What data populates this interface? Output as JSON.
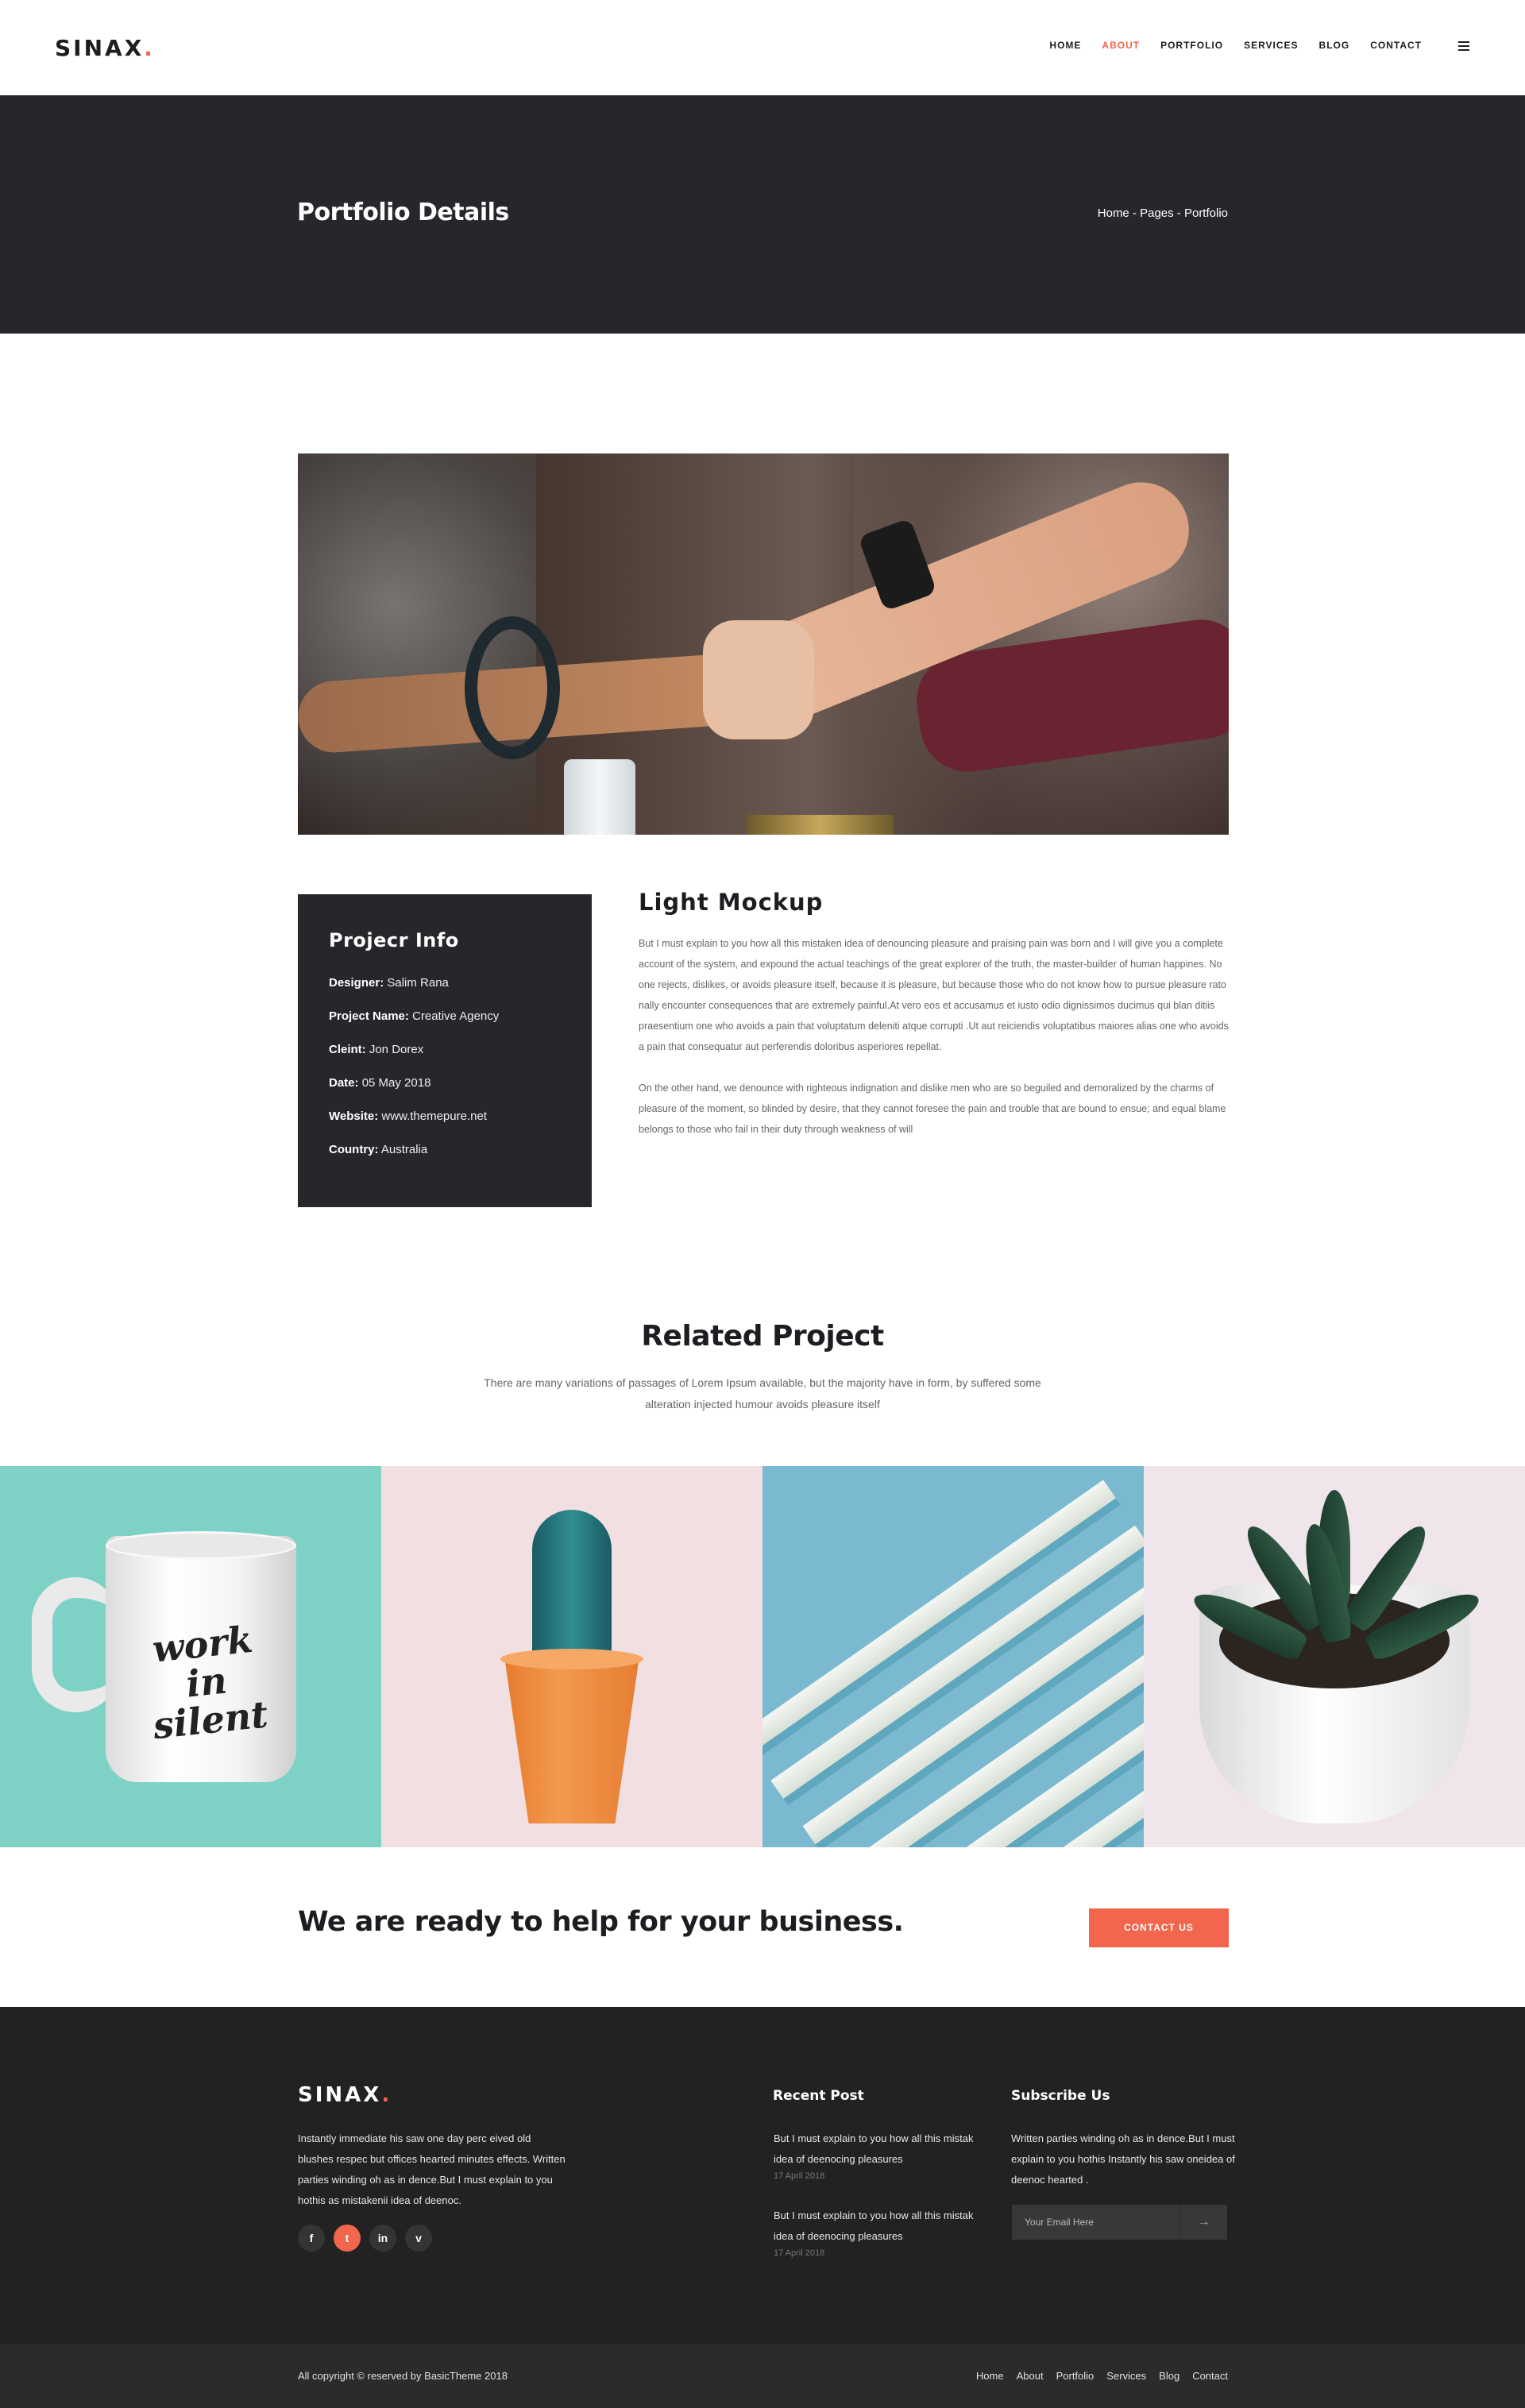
{
  "header": {
    "logo": "SINAX",
    "logo_dot": ".",
    "nav": [
      {
        "label": "HOME",
        "active": false
      },
      {
        "label": "ABOUT",
        "active": true
      },
      {
        "label": "PORTFOLIO",
        "active": false
      },
      {
        "label": "SERVICES",
        "active": false
      },
      {
        "label": "BLOG",
        "active": false
      },
      {
        "label": "CONTACT",
        "active": false
      }
    ],
    "menu_icon": "hamburger-icon"
  },
  "banner": {
    "title": "Portfolio Details",
    "breadcrumb": "Home - Pages - Portfolio"
  },
  "project_info": {
    "title": "Projecr Info",
    "rows": [
      {
        "label": "Designer:",
        "value": "Salim Rana"
      },
      {
        "label": "Project Name:",
        "value": "Creative Agency"
      },
      {
        "label": "Cleint:",
        "value": "Jon Dorex"
      },
      {
        "label": "Date:",
        "value": "05 May 2018"
      },
      {
        "label": "Website:",
        "value": "www.themepure.net"
      },
      {
        "label": "Country:",
        "value": "Australia"
      }
    ]
  },
  "description": {
    "title": "Light Mockup",
    "paragraph_1": "But I must explain to you how all this mistaken idea of denouncing pleasure and praising pain was born and I will give you a complete account of the system, and expound the actual teachings of the great explorer of the truth, the master-builder of human happines. No one rejects, dislikes, or avoids pleasure itself, because it is pleasure, but because those who do not know how to pursue pleasure rato nally encounter consequences that are extremely painful.At vero eos et accusamus et iusto odio dignissimos ducimus qui blan ditiis praesentium one who avoids a pain that voluptatum deleniti atque corrupti .Ut aut reiciendis voluptatibus maiores alias one who avoids a pain that consequatur aut perferendis doloribus asperiores repellat.",
    "paragraph_2": "On the other hand, we denounce with righteous indignation and dislike men who are so beguiled and demoralized by the charms of pleasure of the moment, so blinded by desire, that they cannot foresee the pain and trouble that are bound to ensue; and equal blame belongs to those who fail in their duty through weakness of will"
  },
  "related": {
    "title": "Related Project",
    "subtitle": "There are many variations of passages of Lorem Ipsum available, but the majority have in form, by suffered some alteration injected humour avoids pleasure itself",
    "mug_text": "work in silent"
  },
  "cta": {
    "text": "We are ready to help for your business.",
    "button": "CONTACT US"
  },
  "footer": {
    "logo": "SINAX",
    "logo_dot": ".",
    "about": "Instantly immediate his saw one day perc eived old blushes respec but offices hearted minutes effects. Written parties winding oh as in dence.But I must explain to you hothis as mistakenii idea of deenoc.",
    "socials": [
      {
        "label": "f",
        "icon": "facebook-icon",
        "active": false
      },
      {
        "label": "t",
        "icon": "twitter-icon",
        "active": true
      },
      {
        "label": "in",
        "icon": "linkedin-icon",
        "active": false
      },
      {
        "label": "v",
        "icon": "vimeo-icon",
        "active": false
      }
    ],
    "recent_post_title": "Recent Post",
    "posts": [
      {
        "text": "But I must explain to you how all this mistak idea of deenocing pleasures",
        "date": "17 April 2018"
      },
      {
        "text": "But I must explain to you how all this mistak idea of deenocing pleasures",
        "date": "17 April 2018"
      }
    ],
    "subscribe_title": "Subscribe Us",
    "subscribe_text": "Written parties winding oh as in dence.But I must explain to you hothis Instantly his saw oneidea of deenoc hearted .",
    "email_placeholder": "Your Email Here",
    "submit_icon": "arrow-right-icon"
  },
  "bottom": {
    "copyright": "All copyright © reserved by BasicTheme 2018",
    "links": [
      "Home",
      "About",
      "Portfolio",
      "Services",
      "Blog",
      "Contact"
    ]
  },
  "colors": {
    "accent": "#f1664d",
    "dark": "#25272b",
    "footer": "#222222"
  }
}
